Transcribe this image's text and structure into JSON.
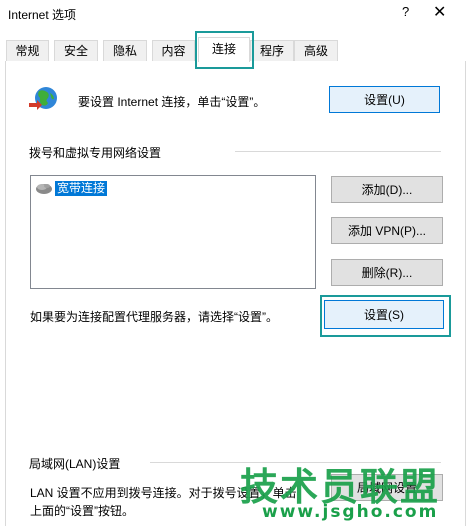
{
  "window": {
    "title": "Internet 选项",
    "help_symbol": "?",
    "close_symbol": "✕"
  },
  "tabs": [
    {
      "label": "常规"
    },
    {
      "label": "安全"
    },
    {
      "label": "隐私"
    },
    {
      "label": "内容"
    },
    {
      "label": "连接",
      "active": true
    },
    {
      "label": "程序"
    },
    {
      "label": "高级"
    }
  ],
  "setup": {
    "text": "要设置 Internet 连接，单击“设置”。",
    "button_label": "设置(U)",
    "icon": "globe-network-icon"
  },
  "dialup": {
    "group_label": "拨号和虚拟专用网络设置",
    "connections": [
      {
        "label": "宽带连接",
        "icon": "broadband-connection-icon"
      }
    ],
    "add_label": "添加(D)...",
    "add_vpn_label": "添加 VPN(P)...",
    "remove_label": "删除(R)...",
    "proxy_text": "如果要为连接配置代理服务器，请选择“设置”。",
    "settings_label": "设置(S)"
  },
  "lan": {
    "group_label": "局域网(LAN)设置",
    "text_line1": "LAN 设置不应用到拨号连接。对于拨号设置，单击",
    "text_line2": "上面的“设置”按钮。",
    "button_label": "局域网设置"
  },
  "watermark": {
    "title": "技术员联盟",
    "url": "www.jsgho.com"
  },
  "colors": {
    "highlight": "#1a9a9a",
    "selection": "#0078d7",
    "watermark_green": "#1aa04a"
  }
}
